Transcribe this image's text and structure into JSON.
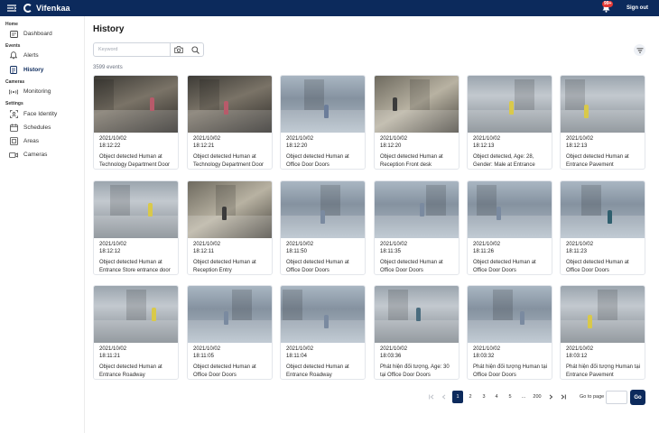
{
  "header": {
    "brand": "Vifenkaa",
    "notification_badge": "99+",
    "sign_out": "Sign out"
  },
  "sidebar": {
    "sections": {
      "home": "Home",
      "events": "Events",
      "cameras": "Cameras",
      "settings": "Settings"
    },
    "items": {
      "dashboard": "Dashboard",
      "alerts": "Alerts",
      "history": "History",
      "monitoring": "Monitoring",
      "face_identity": "Face Identity",
      "schedules": "Schedules",
      "areas": "Areas",
      "cameras": "Cameras"
    },
    "active": "history"
  },
  "main": {
    "title": "History",
    "search_placeholder": "Keyword",
    "event_count": "3599 events"
  },
  "events": [
    {
      "date": "2021/10/02",
      "time": "18:12:22",
      "desc": "Object detected Human at Technology Department Door"
    },
    {
      "date": "2021/10/02",
      "time": "18:12:21",
      "desc": "Object detected Human at Technology Department Door"
    },
    {
      "date": "2021/10/02",
      "time": "18:12:20",
      "desc": "Object detected Human at Office Door Doors"
    },
    {
      "date": "2021/10/02",
      "time": "18:12:20",
      "desc": "Object detected Human at Reception Front desk"
    },
    {
      "date": "2021/10/02",
      "time": "18:12:13",
      "desc": "Object detected, Age: 28, Gender: Male at Entrance Pavement"
    },
    {
      "date": "2021/10/02",
      "time": "18:12:13",
      "desc": "Object detected Human at Entrance Pavement"
    },
    {
      "date": "2021/10/02",
      "time": "18:12:12",
      "desc": "Object detected Human at Entrance Store entrance door"
    },
    {
      "date": "2021/10/02",
      "time": "18:12:11",
      "desc": "Object detected Human at Reception Entry"
    },
    {
      "date": "2021/10/02",
      "time": "18:11:50",
      "desc": "Object detected Human at Office Door Doors"
    },
    {
      "date": "2021/10/02",
      "time": "18:11:35",
      "desc": "Object detected Human at Office Door Doors"
    },
    {
      "date": "2021/10/02",
      "time": "18:11:26",
      "desc": "Object detected Human at Office Door Doors"
    },
    {
      "date": "2021/10/02",
      "time": "18:11:23",
      "desc": "Object detected Human at Office Door Doors"
    },
    {
      "date": "2021/10/02",
      "time": "18:11:21",
      "desc": "Object detected Human at Entrance Roadway"
    },
    {
      "date": "2021/10/02",
      "time": "18:11:05",
      "desc": "Object detected Human at Office Door Doors"
    },
    {
      "date": "2021/10/02",
      "time": "18:11:04",
      "desc": "Object detected Human at Entrance Roadway"
    },
    {
      "date": "2021/10/02",
      "time": "18:03:36",
      "desc": "Phát hiện đối tượng, Age: 30 tại Office Door Doors"
    },
    {
      "date": "2021/10/02",
      "time": "18:03:32",
      "desc": "Phát hiện đối tượng Human tại Office Door Doors"
    },
    {
      "date": "2021/10/02",
      "time": "18:03:12",
      "desc": "Phát hiện đối tượng Human tại Entrance Pavement"
    }
  ],
  "pagination": {
    "pages": [
      "1",
      "2",
      "3",
      "4",
      "5",
      "...",
      "200"
    ],
    "current": "1",
    "goto_label": "Go to page",
    "go_button": "Go"
  },
  "colors": {
    "header_bg": "#0c2a5c",
    "accent": "#0c2a5c",
    "badge": "#e53935"
  }
}
